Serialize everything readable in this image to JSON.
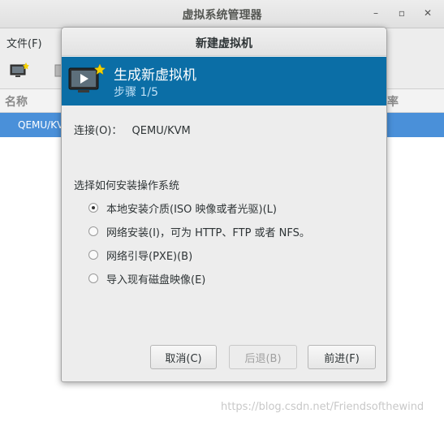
{
  "main": {
    "title": "虚拟系统管理器",
    "menu_file": "文件(F)",
    "col_name": "名称",
    "col_rate": "率",
    "row_selected": "QEMU/KVM"
  },
  "dialog": {
    "title": "新建虚拟机",
    "banner_title": "生成新虚拟机",
    "banner_step": "步骤 1/5",
    "connection_label": "连接(O)：",
    "connection_value": "QEMU/KVM",
    "section_label": "选择如何安装操作系统",
    "options": [
      {
        "label": "本地安装介质(ISO 映像或者光驱)(L)",
        "checked": true
      },
      {
        "label": "网络安装(I)，可为 HTTP、FTP 或者 NFS。",
        "checked": false
      },
      {
        "label": "网络引导(PXE)(B)",
        "checked": false
      },
      {
        "label": "导入现有磁盘映像(E)",
        "checked": false
      }
    ],
    "buttons": {
      "cancel": "取消(C)",
      "back": "后退(B)",
      "forward": "前进(F)"
    }
  },
  "watermark": "https://blog.csdn.net/Friendsofthewind",
  "colors": {
    "banner": "#0b6ea6",
    "selection": "#4a90d9"
  }
}
